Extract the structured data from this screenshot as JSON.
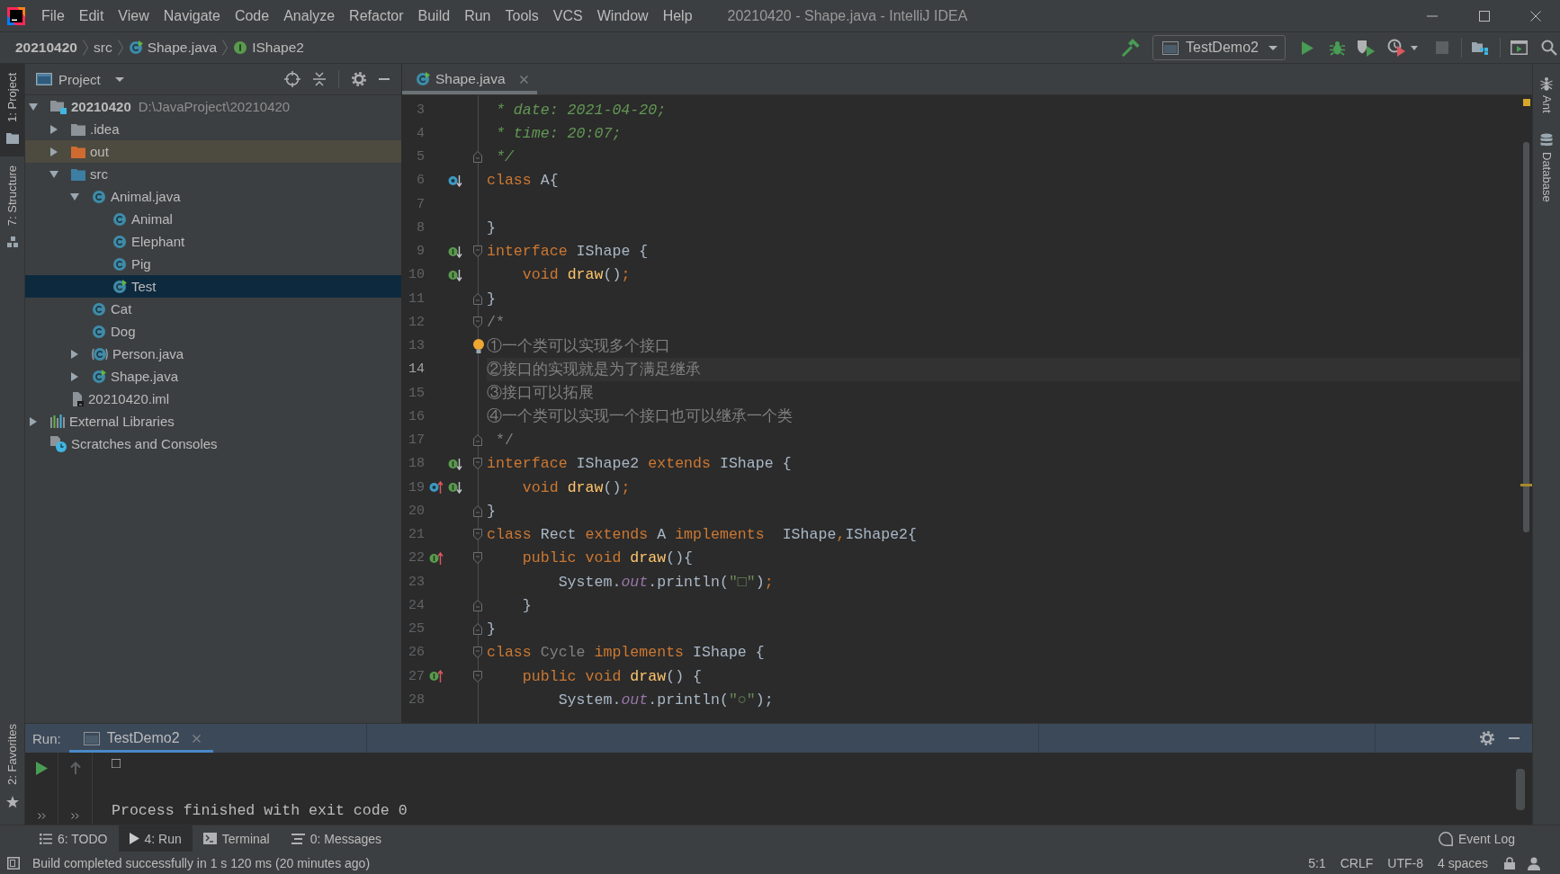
{
  "window": {
    "title": "20210420 - Shape.java - IntelliJ IDEA"
  },
  "menu": [
    "File",
    "Edit",
    "View",
    "Navigate",
    "Code",
    "Analyze",
    "Refactor",
    "Build",
    "Run",
    "Tools",
    "VCS",
    "Window",
    "Help"
  ],
  "breadcrumbs": [
    {
      "label": "20210420",
      "kind": "module"
    },
    {
      "label": "src",
      "kind": "folder"
    },
    {
      "label": "Shape.java",
      "kind": "runnable-class"
    },
    {
      "label": "IShape2",
      "kind": "interface"
    }
  ],
  "toolbar": {
    "run_configuration": "TestDemo2"
  },
  "left_tool_windows": [
    {
      "label": "1: Project",
      "kind": "project",
      "selected": true
    },
    {
      "label": "7: Structure",
      "kind": "structure",
      "selected": false
    },
    {
      "label": "2: Favorites",
      "kind": "favorites",
      "selected": false
    }
  ],
  "right_tool_windows": [
    {
      "label": "Ant",
      "kind": "ant"
    },
    {
      "label": "Database",
      "kind": "database"
    }
  ],
  "project_panel": {
    "title": "Project",
    "tree": [
      {
        "label": "20210420",
        "path": "D:\\JavaProject\\20210420",
        "kind": "module",
        "expanded": true,
        "selected": false,
        "children": [
          {
            "label": ".idea",
            "kind": "folder",
            "expanded": false,
            "selected": false
          },
          {
            "label": "out",
            "kind": "excluded-folder",
            "expanded": false,
            "selected": false
          },
          {
            "label": "src",
            "kind": "source-folder",
            "expanded": true,
            "selected": false,
            "children": [
              {
                "label": "Animal.java",
                "kind": "class",
                "expanded": true,
                "selected": false,
                "children": [
                  {
                    "label": "Animal",
                    "kind": "class",
                    "selected": false
                  },
                  {
                    "label": "Elephant",
                    "kind": "class",
                    "selected": false
                  },
                  {
                    "label": "Pig",
                    "kind": "class",
                    "selected": false
                  },
                  {
                    "label": "Test",
                    "kind": "runnable-class",
                    "selected": true
                  }
                ]
              },
              {
                "label": "Cat",
                "kind": "class",
                "selected": false
              },
              {
                "label": "Dog",
                "kind": "class",
                "selected": false
              },
              {
                "label": "Person.java",
                "kind": "class-file",
                "expanded": false,
                "selected": false
              },
              {
                "label": "Shape.java",
                "kind": "runnable-class",
                "expanded": false,
                "selected": false
              }
            ]
          },
          {
            "label": "20210420.iml",
            "kind": "module-file",
            "selected": false
          }
        ]
      },
      {
        "label": "External Libraries",
        "kind": "libraries",
        "expanded": false,
        "selected": false
      },
      {
        "label": "Scratches and Consoles",
        "kind": "scratches",
        "selected": false
      }
    ]
  },
  "editor": {
    "tabs": [
      {
        "label": "Shape.java",
        "kind": "runnable-class",
        "selected": true
      }
    ],
    "lines": [
      {
        "number": "3",
        "tokens": [
          {
            "text": " * date: 2021-04-20;",
            "kind": "doc"
          }
        ]
      },
      {
        "number": "4",
        "tokens": [
          {
            "text": " * time: 20:07;",
            "kind": "doc"
          }
        ]
      },
      {
        "number": "5",
        "fold": {
          "kind": "end"
        },
        "tokens": [
          {
            "text": " */",
            "kind": "doc"
          }
        ]
      },
      {
        "number": "6",
        "gutter": [
          {
            "kind": "subclassed"
          }
        ],
        "tokens": [
          {
            "text": "class ",
            "kind": "keyword"
          },
          {
            "text": "A{",
            "kind": "plain"
          }
        ]
      },
      {
        "number": "7"
      },
      {
        "number": "8",
        "tokens": [
          {
            "text": "}",
            "kind": "plain"
          }
        ]
      },
      {
        "number": "9",
        "gutter": [
          {
            "kind": "implemented"
          }
        ],
        "fold": {
          "kind": "start"
        },
        "tokens": [
          {
            "text": "interface ",
            "kind": "keyword"
          },
          {
            "text": "IShape {",
            "kind": "plain"
          }
        ]
      },
      {
        "number": "10",
        "gutter": [
          {
            "kind": "implemented"
          }
        ],
        "tokens": [
          {
            "text": "    void ",
            "kind": "keyword"
          },
          {
            "text": "draw",
            "kind": "method"
          },
          {
            "text": "()",
            "kind": "plain"
          },
          {
            "text": ";",
            "kind": "keyword"
          }
        ]
      },
      {
        "number": "11",
        "fold": {
          "kind": "end"
        },
        "tokens": [
          {
            "text": "}",
            "kind": "plain"
          }
        ]
      },
      {
        "number": "12",
        "fold": {
          "kind": "start"
        },
        "tokens": [
          {
            "text": "/*",
            "kind": "comment"
          }
        ]
      },
      {
        "number": "13",
        "bulb": true,
        "tokens": [
          {
            "text": "①一个类可以实现多个接口",
            "kind": "comment"
          }
        ]
      },
      {
        "number": "14",
        "current": true,
        "tokens": [
          {
            "text": "②接口的实现就是为了满足继承",
            "kind": "comment"
          }
        ]
      },
      {
        "number": "15",
        "tokens": [
          {
            "text": "③接口可以拓展",
            "kind": "comment"
          }
        ]
      },
      {
        "number": "16",
        "tokens": [
          {
            "text": "④一个类可以实现一个接口也可以继承一个类",
            "kind": "comment"
          }
        ]
      },
      {
        "number": "17",
        "fold": {
          "kind": "end"
        },
        "tokens": [
          {
            "text": " */",
            "kind": "comment"
          }
        ]
      },
      {
        "number": "18",
        "gutter": [
          {
            "kind": "implemented"
          }
        ],
        "fold": {
          "kind": "start"
        },
        "tokens": [
          {
            "text": "interface ",
            "kind": "keyword"
          },
          {
            "text": "IShape2 ",
            "kind": "plain"
          },
          {
            "text": "extends ",
            "kind": "keyword"
          },
          {
            "text": "IShape {",
            "kind": "plain"
          }
        ]
      },
      {
        "number": "19",
        "gutter": [
          {
            "kind": "overrides"
          },
          {
            "kind": "implemented"
          }
        ],
        "tokens": [
          {
            "text": "    void ",
            "kind": "keyword"
          },
          {
            "text": "draw",
            "kind": "method"
          },
          {
            "text": "()",
            "kind": "plain"
          },
          {
            "text": ";",
            "kind": "keyword"
          }
        ]
      },
      {
        "number": "20",
        "fold": {
          "kind": "end"
        },
        "tokens": [
          {
            "text": "}",
            "kind": "plain"
          }
        ]
      },
      {
        "number": "21",
        "fold": {
          "kind": "start"
        },
        "tokens": [
          {
            "text": "class ",
            "kind": "keyword"
          },
          {
            "text": "Rect ",
            "kind": "plain"
          },
          {
            "text": "extends ",
            "kind": "keyword"
          },
          {
            "text": "A ",
            "kind": "plain"
          },
          {
            "text": "implements ",
            "kind": "keyword"
          },
          {
            "text": " IShape",
            "kind": "plain"
          },
          {
            "text": ",",
            "kind": "keyword"
          },
          {
            "text": "IShape2{",
            "kind": "plain"
          }
        ]
      },
      {
        "number": "22",
        "gutter": [
          {
            "kind": "implements"
          }
        ],
        "fold": {
          "kind": "start"
        },
        "tokens": [
          {
            "text": "    public void ",
            "kind": "keyword"
          },
          {
            "text": "draw",
            "kind": "method"
          },
          {
            "text": "(){",
            "kind": "plain"
          }
        ]
      },
      {
        "number": "23",
        "tokens": [
          {
            "text": "        System.",
            "kind": "plain"
          },
          {
            "text": "out",
            "kind": "field"
          },
          {
            "text": ".println(",
            "kind": "plain"
          },
          {
            "text": "\"□\"",
            "kind": "string"
          },
          {
            "text": ")",
            "kind": "plain"
          },
          {
            "text": ";",
            "kind": "keyword"
          }
        ]
      },
      {
        "number": "24",
        "fold": {
          "kind": "end"
        },
        "tokens": [
          {
            "text": "    }",
            "kind": "plain"
          }
        ]
      },
      {
        "number": "25",
        "fold": {
          "kind": "end"
        },
        "tokens": [
          {
            "text": "}",
            "kind": "plain"
          }
        ]
      },
      {
        "number": "26",
        "fold": {
          "kind": "start"
        },
        "tokens": [
          {
            "text": "class ",
            "kind": "keyword"
          },
          {
            "text": "Cycle ",
            "kind": "unused"
          },
          {
            "text": "implements ",
            "kind": "keyword"
          },
          {
            "text": "IShape {",
            "kind": "plain"
          }
        ]
      },
      {
        "number": "27",
        "gutter": [
          {
            "kind": "implements"
          }
        ],
        "fold": {
          "kind": "start"
        },
        "tokens": [
          {
            "text": "    public void ",
            "kind": "keyword"
          },
          {
            "text": "draw",
            "kind": "method"
          },
          {
            "text": "() {",
            "kind": "plain"
          }
        ]
      },
      {
        "number": "28",
        "tokens": [
          {
            "text": "        System.",
            "kind": "plain"
          },
          {
            "text": "out",
            "kind": "field"
          },
          {
            "text": ".println(",
            "kind": "plain"
          },
          {
            "text": "\"○\"",
            "kind": "string"
          },
          {
            "text": ");",
            "kind": "plain"
          }
        ]
      }
    ]
  },
  "run_panel": {
    "title": "Run:",
    "tabs": [
      {
        "label": "TestDemo2",
        "selected": true
      }
    ],
    "output": "□\n\nProcess finished with exit code 0"
  },
  "tool_tabs": [
    {
      "label": "6: TODO",
      "kind": "todo",
      "selected": false
    },
    {
      "label": "4: Run",
      "kind": "run",
      "selected": true
    },
    {
      "label": "Terminal",
      "kind": "terminal",
      "selected": false
    },
    {
      "label": "0: Messages",
      "kind": "messages",
      "selected": false
    }
  ],
  "event_log": "Event Log",
  "status_bar": {
    "message": "Build completed successfully in 1 s 120 ms (20 minutes ago)",
    "position": "5:1",
    "line_separator": "CRLF",
    "encoding": "UTF-8",
    "indent": "4 spaces"
  }
}
